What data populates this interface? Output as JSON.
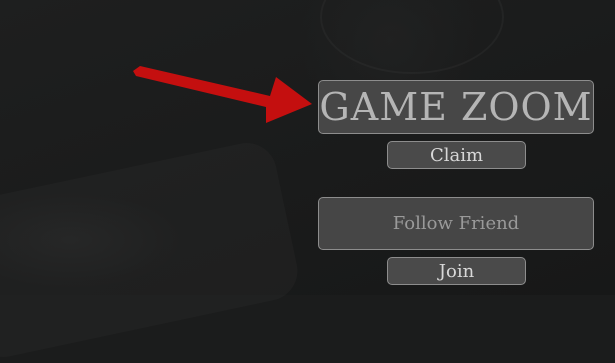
{
  "game_zoom_button": {
    "label": "GAME ZOOM"
  },
  "claim_button": {
    "label": "Claim"
  },
  "follow_friend_button": {
    "label": "Follow Friend"
  },
  "join_button": {
    "label": "Join"
  },
  "annotation": {
    "icon": "pointer-arrow-icon",
    "color": "#c40f0f"
  }
}
